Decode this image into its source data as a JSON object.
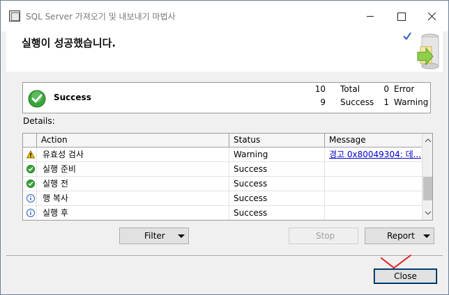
{
  "window": {
    "title": "SQL Server 가져오기 및 내보내기 마법사",
    "min_glyph": "",
    "max_glyph": "",
    "close_glyph": ""
  },
  "header": {
    "title": "실행이 성공했습니다."
  },
  "summary": {
    "status": "Success",
    "total_count": "10",
    "total_label": "Total",
    "error_count": "0",
    "error_label": "Error",
    "success_count": "9",
    "success_label": "Success",
    "warning_count": "1",
    "warning_label": "Warning"
  },
  "details": {
    "label": "Details:",
    "columns": [
      "Action",
      "Status",
      "Message"
    ],
    "rows": [
      {
        "icon": "warning-icon",
        "action": "유효성 검사",
        "status": "Warning",
        "message": "경고 0x80049304: 데..."
      },
      {
        "icon": "success-icon",
        "action": "실행 준비",
        "status": "Success",
        "message": ""
      },
      {
        "icon": "success-icon",
        "action": "실행 전",
        "status": "Success",
        "message": ""
      },
      {
        "icon": "info-icon",
        "action": "행 복사",
        "status": "Success",
        "message": ""
      },
      {
        "icon": "info-icon",
        "action": "실행 후",
        "status": "Success",
        "message": ""
      }
    ]
  },
  "buttons": {
    "filter": "Filter",
    "stop": "Stop",
    "report": "Report",
    "close": "Close"
  },
  "colors": {
    "accent": "#0078d7",
    "link": "#0000cc",
    "success_green": "#3aa33a",
    "warning_yellow": "#f5c400",
    "annotation_red": "#e02020"
  }
}
